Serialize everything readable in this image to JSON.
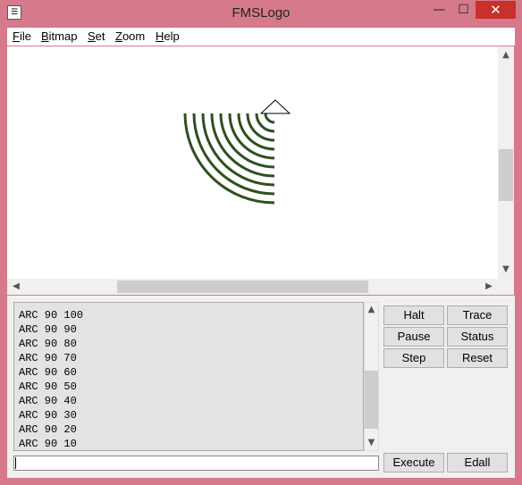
{
  "window": {
    "title": "FMSLogo",
    "app_icon": "logo-turtle-icon",
    "controls": {
      "minimize": "—",
      "maximize": "☐",
      "close": "✕"
    }
  },
  "menu": [
    {
      "label": "File",
      "accel": "F",
      "rest": "ile"
    },
    {
      "label": "Bitmap",
      "accel": "B",
      "rest": "itmap"
    },
    {
      "label": "Set",
      "accel": "S",
      "rest": "et"
    },
    {
      "label": "Zoom",
      "accel": "Z",
      "rest": "oom"
    },
    {
      "label": "Help",
      "accel": "H",
      "rest": "elp"
    }
  ],
  "canvas": {
    "pen_color": "#2f4f1f",
    "arc_radii": [
      100,
      90,
      80,
      70,
      60,
      50,
      40,
      30,
      20,
      10
    ],
    "arc_angle": 90,
    "turtle_icon": "turtle-triangle-icon"
  },
  "history": [
    "ARC 90 100",
    "ARC 90 90",
    "ARC 90 80",
    "ARC 90 70",
    "ARC 90 60",
    "ARC 90 50",
    "ARC 90 40",
    "ARC 90 30",
    "ARC 90 20",
    "ARC 90 10"
  ],
  "input": {
    "value": ""
  },
  "buttons": {
    "halt": "Halt",
    "trace": "Trace",
    "pause": "Pause",
    "status": "Status",
    "step": "Step",
    "reset": "Reset",
    "execute": "Execute",
    "edall": "Edall"
  },
  "scroll_icons": {
    "up": "▲",
    "down": "▼",
    "left": "◀",
    "right": "▶"
  }
}
